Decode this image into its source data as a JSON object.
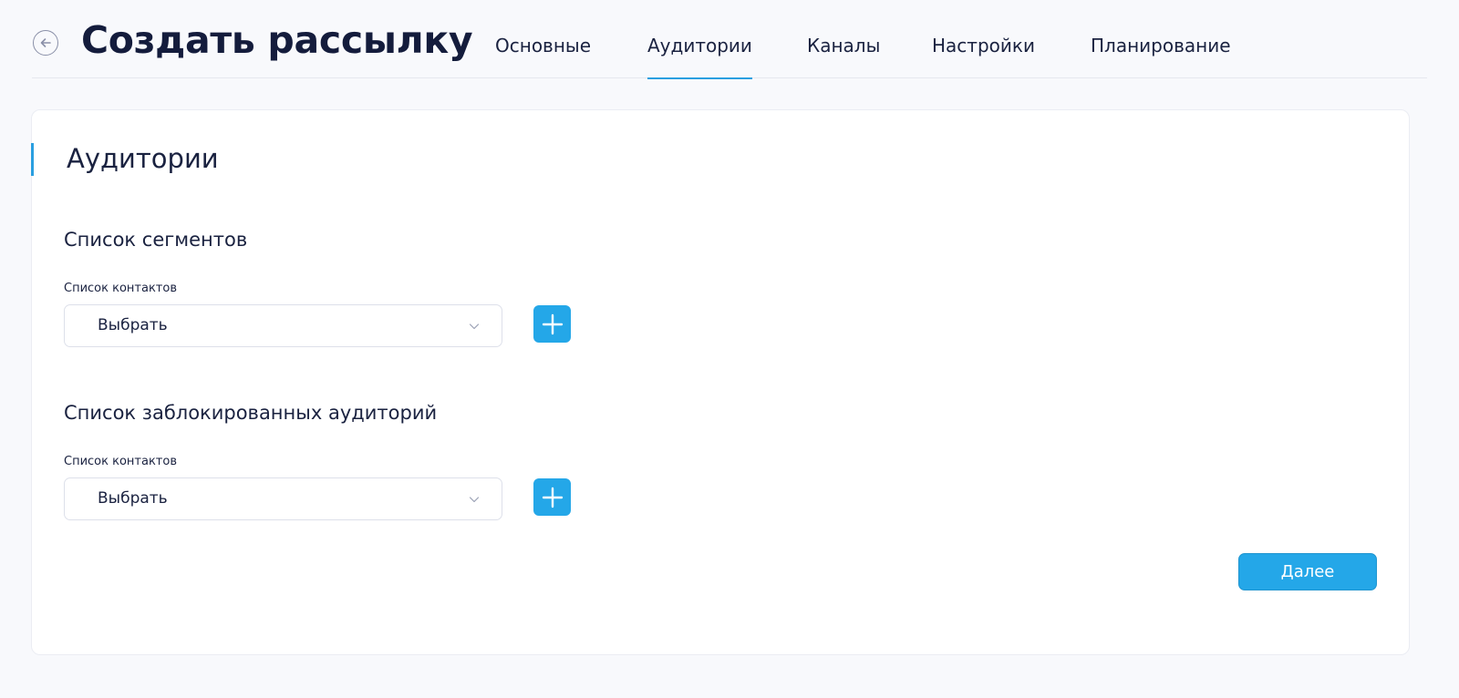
{
  "header": {
    "title": "Создать рассылку",
    "tabs": [
      {
        "label": "Основные"
      },
      {
        "label": "Аудитории",
        "active": true
      },
      {
        "label": "Каналы"
      },
      {
        "label": "Настройки"
      },
      {
        "label": "Планирование"
      }
    ]
  },
  "card": {
    "title": "Аудитории",
    "sections": [
      {
        "title": "Список сегментов",
        "field_label": "Список контактов",
        "select_value": "Выбрать"
      },
      {
        "title": "Список заблокированных аудиторий",
        "field_label": "Список контактов",
        "select_value": "Выбрать"
      }
    ],
    "next_label": "Далее"
  },
  "colors": {
    "accent": "#24a7e8",
    "title": "#141c3c",
    "background": "#f8f9fc"
  },
  "icons": {
    "back": "arrow-left-circle-icon",
    "chevron": "chevron-down-icon",
    "add": "plus-icon"
  }
}
